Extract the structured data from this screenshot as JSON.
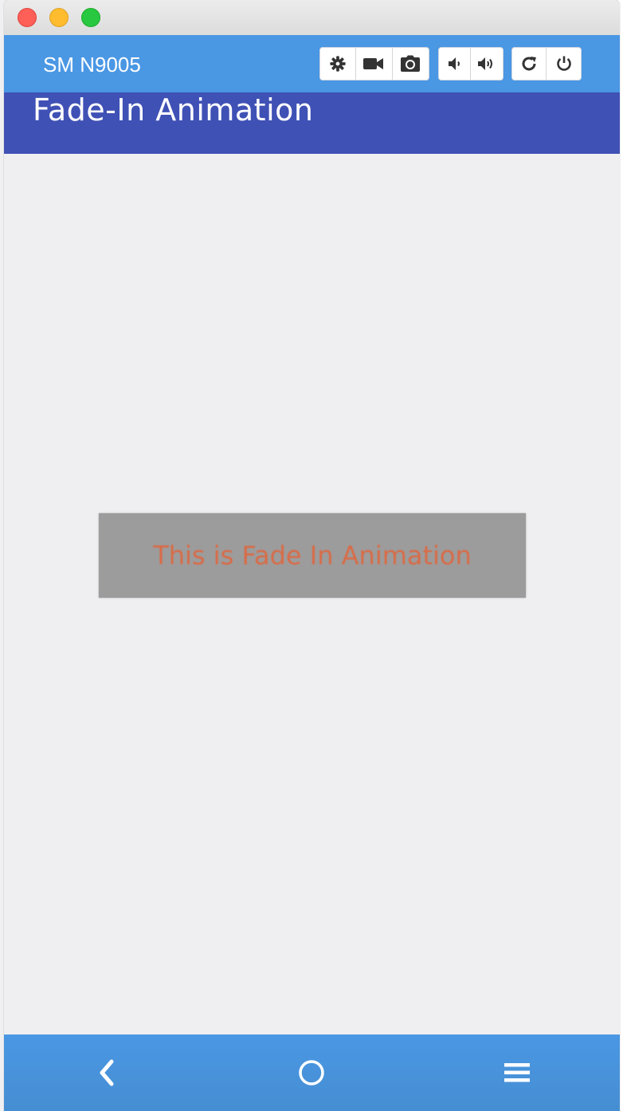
{
  "window": {
    "controls": [
      "close",
      "minimize",
      "maximize"
    ]
  },
  "device_bar": {
    "device_name": "SM N9005",
    "button_groups": [
      {
        "icons": [
          "gear-icon",
          "video-camera-icon",
          "camera-icon"
        ]
      },
      {
        "icons": [
          "volume-down-icon",
          "volume-up-icon"
        ]
      },
      {
        "icons": [
          "rotate-icon",
          "power-icon"
        ]
      }
    ]
  },
  "app": {
    "title": "Fade-In Animation",
    "animated_label": "This is Fade In Animation"
  },
  "nav_bar": {
    "icons": [
      "back-icon",
      "home-icon",
      "menu-icon"
    ]
  },
  "colors": {
    "device_bar": "#4a97e4",
    "app_bar": "#3f51b5",
    "content_bg": "#efeff1",
    "fade_box": "#9c9c9c",
    "fade_text": "#e0663e"
  }
}
